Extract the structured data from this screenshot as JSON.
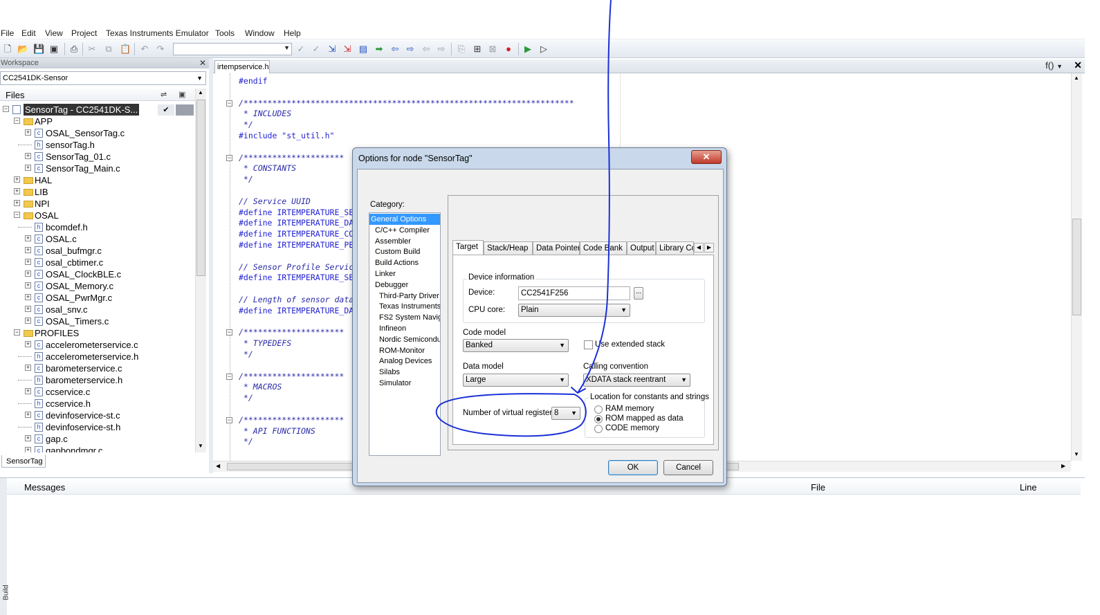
{
  "menu": [
    "File",
    "Edit",
    "View",
    "Project",
    "Texas Instruments Emulator",
    "Tools",
    "Window",
    "Help"
  ],
  "workspace": {
    "title": "Workspace",
    "config": "CC2541DK-Sensor",
    "files_label": "Files",
    "tab": "SensorTag",
    "tree": [
      {
        "label": "SensorTag - CC2541DK-S...",
        "type": "proj",
        "depth": 0,
        "exp": "−"
      },
      {
        "label": "APP",
        "type": "folder",
        "depth": 1,
        "exp": "−"
      },
      {
        "label": "OSAL_SensorTag.c",
        "type": "c",
        "depth": 2,
        "exp": "+"
      },
      {
        "label": "sensorTag.h",
        "type": "h",
        "depth": 2,
        "exp": ""
      },
      {
        "label": "SensorTag_01.c",
        "type": "c",
        "depth": 2,
        "exp": "+"
      },
      {
        "label": "SensorTag_Main.c",
        "type": "c",
        "depth": 2,
        "exp": "+"
      },
      {
        "label": "HAL",
        "type": "folder",
        "depth": 1,
        "exp": "+"
      },
      {
        "label": "LIB",
        "type": "folder",
        "depth": 1,
        "exp": "+"
      },
      {
        "label": "NPI",
        "type": "folder",
        "depth": 1,
        "exp": "+"
      },
      {
        "label": "OSAL",
        "type": "folder",
        "depth": 1,
        "exp": "−"
      },
      {
        "label": "bcomdef.h",
        "type": "h",
        "depth": 2,
        "exp": ""
      },
      {
        "label": "OSAL.c",
        "type": "c",
        "depth": 2,
        "exp": "+"
      },
      {
        "label": "osal_bufmgr.c",
        "type": "c",
        "depth": 2,
        "exp": "+"
      },
      {
        "label": "osal_cbtimer.c",
        "type": "c",
        "depth": 2,
        "exp": "+"
      },
      {
        "label": "OSAL_ClockBLE.c",
        "type": "c",
        "depth": 2,
        "exp": "+"
      },
      {
        "label": "OSAL_Memory.c",
        "type": "c",
        "depth": 2,
        "exp": "+"
      },
      {
        "label": "OSAL_PwrMgr.c",
        "type": "c",
        "depth": 2,
        "exp": "+"
      },
      {
        "label": "osal_snv.c",
        "type": "c",
        "depth": 2,
        "exp": "+"
      },
      {
        "label": "OSAL_Timers.c",
        "type": "c",
        "depth": 2,
        "exp": "+"
      },
      {
        "label": "PROFILES",
        "type": "folder",
        "depth": 1,
        "exp": "−"
      },
      {
        "label": "accelerometerservice.c",
        "type": "c",
        "depth": 2,
        "exp": "+"
      },
      {
        "label": "accelerometerservice.h",
        "type": "h",
        "depth": 2,
        "exp": ""
      },
      {
        "label": "barometerservice.c",
        "type": "c",
        "depth": 2,
        "exp": "+"
      },
      {
        "label": "barometerservice.h",
        "type": "h",
        "depth": 2,
        "exp": ""
      },
      {
        "label": "ccservice.c",
        "type": "c",
        "depth": 2,
        "exp": "+"
      },
      {
        "label": "ccservice.h",
        "type": "h",
        "depth": 2,
        "exp": ""
      },
      {
        "label": "devinfoservice-st.c",
        "type": "c",
        "depth": 2,
        "exp": "+"
      },
      {
        "label": "devinfoservice-st.h",
        "type": "h",
        "depth": 2,
        "exp": ""
      },
      {
        "label": "gap.c",
        "type": "c",
        "depth": 2,
        "exp": "+"
      },
      {
        "label": "gapbondmgr.c",
        "type": "c",
        "depth": 2,
        "exp": "+"
      }
    ],
    "check": "✔"
  },
  "editor": {
    "tab": "irtempservice.h",
    "function_box": "f()",
    "lines": [
      {
        "text": "#endif",
        "cls": "",
        "fold": false
      },
      {
        "text": "",
        "cls": "",
        "fold": false
      },
      {
        "text": "/*********************************************************************",
        "cls": "comment",
        "fold": true
      },
      {
        "text": " * INCLUDES",
        "cls": "comment",
        "fold": false
      },
      {
        "text": " */",
        "cls": "comment",
        "fold": false
      },
      {
        "text": "#include \"st_util.h\"",
        "cls": "",
        "fold": false
      },
      {
        "text": "",
        "cls": "",
        "fold": false
      },
      {
        "text": "/*********************",
        "cls": "comment",
        "fold": true
      },
      {
        "text": " * CONSTANTS",
        "cls": "comment",
        "fold": false
      },
      {
        "text": " */",
        "cls": "comment",
        "fold": false
      },
      {
        "text": "",
        "cls": "",
        "fold": false
      },
      {
        "text": "// Service UUID",
        "cls": "comment",
        "fold": false
      },
      {
        "text": "#define IRTEMPERATURE_SE",
        "cls": "",
        "fold": false
      },
      {
        "text": "#define IRTEMPERATURE_DA",
        "cls": "",
        "fold": false
      },
      {
        "text": "#define IRTEMPERATURE_CO",
        "cls": "",
        "fold": false
      },
      {
        "text": "#define IRTEMPERATURE_PE",
        "cls": "",
        "fold": false
      },
      {
        "text": "",
        "cls": "",
        "fold": false
      },
      {
        "text": "// Sensor Profile Servic",
        "cls": "comment",
        "fold": false
      },
      {
        "text": "#define IRTEMPERATURE_SE",
        "cls": "",
        "fold": false
      },
      {
        "text": "",
        "cls": "",
        "fold": false
      },
      {
        "text": "// Length of sensor data",
        "cls": "comment",
        "fold": false
      },
      {
        "text": "#define IRTEMPERATURE_DA",
        "cls": "",
        "fold": false
      },
      {
        "text": "",
        "cls": "",
        "fold": false
      },
      {
        "text": "/*********************",
        "cls": "comment",
        "fold": true
      },
      {
        "text": " * TYPEDEFS",
        "cls": "comment",
        "fold": false
      },
      {
        "text": " */",
        "cls": "comment",
        "fold": false
      },
      {
        "text": "",
        "cls": "",
        "fold": false
      },
      {
        "text": "/*********************",
        "cls": "comment",
        "fold": true
      },
      {
        "text": " * MACROS",
        "cls": "comment",
        "fold": false
      },
      {
        "text": " */",
        "cls": "comment",
        "fold": false
      },
      {
        "text": "",
        "cls": "",
        "fold": false
      },
      {
        "text": "/*********************",
        "cls": "comment",
        "fold": true
      },
      {
        "text": " * API FUNCTIONS",
        "cls": "comment",
        "fold": false
      },
      {
        "text": " */",
        "cls": "comment",
        "fold": false
      }
    ]
  },
  "messages": {
    "col_messages": "Messages",
    "col_file": "File",
    "col_line": "Line",
    "side_label": "Build"
  },
  "dialog": {
    "title": "Options for node \"SensorTag\"",
    "close": "✕",
    "category_label": "Category:",
    "categories": [
      {
        "label": "General Options",
        "indent": 0,
        "selected": true
      },
      {
        "label": "C/C++ Compiler",
        "indent": 1,
        "selected": false
      },
      {
        "label": "Assembler",
        "indent": 1,
        "selected": false
      },
      {
        "label": "Custom Build",
        "indent": 1,
        "selected": false
      },
      {
        "label": "Build Actions",
        "indent": 1,
        "selected": false
      },
      {
        "label": "Linker",
        "indent": 1,
        "selected": false
      },
      {
        "label": "Debugger",
        "indent": 1,
        "selected": false
      },
      {
        "label": "Third-Party Driver",
        "indent": 2,
        "selected": false
      },
      {
        "label": "Texas Instruments",
        "indent": 2,
        "selected": false
      },
      {
        "label": "FS2 System Navig",
        "indent": 2,
        "selected": false
      },
      {
        "label": "Infineon",
        "indent": 2,
        "selected": false
      },
      {
        "label": "Nordic Semiconduc",
        "indent": 2,
        "selected": false
      },
      {
        "label": "ROM-Monitor",
        "indent": 2,
        "selected": false
      },
      {
        "label": "Analog Devices",
        "indent": 2,
        "selected": false
      },
      {
        "label": "Silabs",
        "indent": 2,
        "selected": false
      },
      {
        "label": "Simulator",
        "indent": 2,
        "selected": false
      }
    ],
    "tabs": [
      "Target",
      "Stack/Heap",
      "Data Pointer",
      "Code Bank",
      "Output",
      "Library Cor"
    ],
    "active_tab": "Target",
    "device_info_title": "Device information",
    "device_label": "Device:",
    "device_value": "CC2541F256",
    "device_browse": "...",
    "cpu_core_label": "CPU core:",
    "cpu_core_value": "Plain",
    "code_model_label": "Code model",
    "code_model_value": "Banked",
    "extended_stack_label": "Use extended stack",
    "extended_stack_checked": false,
    "data_model_label": "Data model",
    "data_model_value": "Large",
    "calling_convention_label": "Calling convention",
    "calling_convention_value": "XDATA stack reentrant",
    "virtual_registers_label": "Number of virtual registers:",
    "virtual_registers_value": "8",
    "location_title": "Location for constants and strings",
    "location_options": [
      {
        "label": "RAM memory",
        "checked": false
      },
      {
        "label": "ROM mapped as data",
        "checked": true
      },
      {
        "label": "CODE memory",
        "checked": false
      }
    ],
    "ok_label": "OK",
    "cancel_label": "Cancel"
  },
  "annotation": {
    "color": "#1a2fd6"
  }
}
